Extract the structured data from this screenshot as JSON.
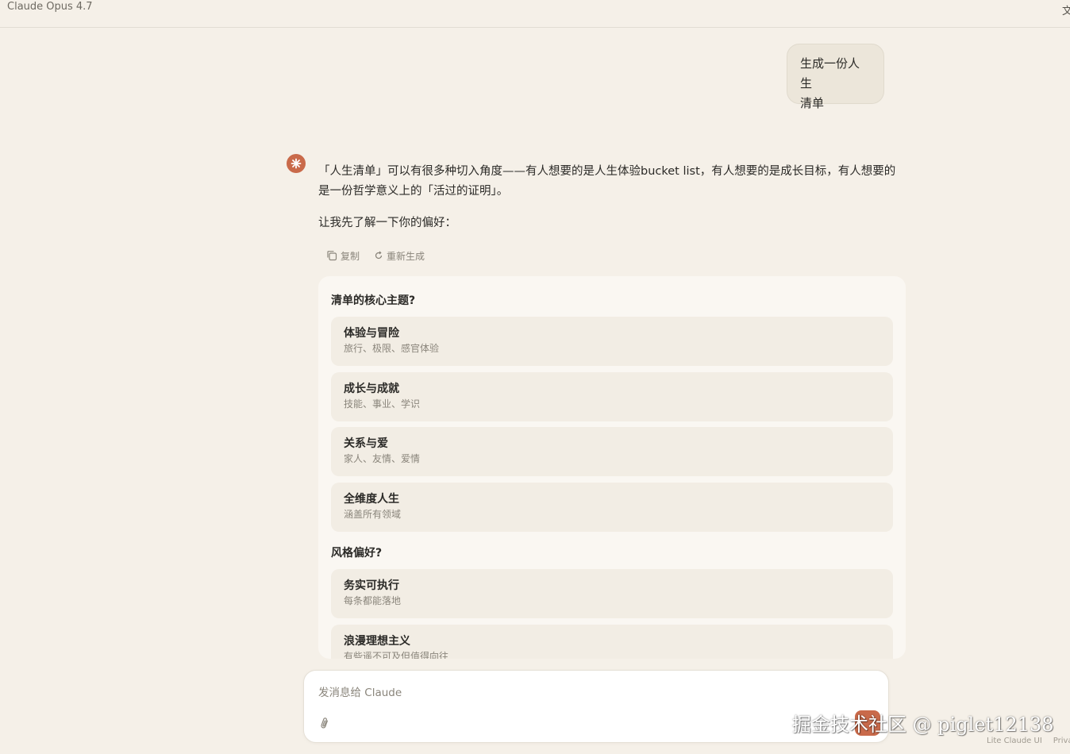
{
  "header": {
    "model_name": "Claude Opus 4.7",
    "translate_glyph": "文"
  },
  "user_message": {
    "line1": "生成一份人生",
    "line2": "清单"
  },
  "assistant": {
    "paragraph1": "「人生清单」可以有很多种切入角度——有人想要的是人生体验bucket list，有人想要的是成长目标，有人想要的是一份哲学意义上的「活过的证明」。",
    "paragraph2": "让我先了解一下你的偏好：",
    "copy_label": "复制",
    "regenerate_label": "重新生成"
  },
  "questions": [
    {
      "title": "清单的核心主题?",
      "options": [
        {
          "title": "体验与冒险",
          "subtitle": "旅行、极限、感官体验"
        },
        {
          "title": "成长与成就",
          "subtitle": "技能、事业、学识"
        },
        {
          "title": "关系与爱",
          "subtitle": "家人、友情、爱情"
        },
        {
          "title": "全维度人生",
          "subtitle": "涵盖所有领域"
        }
      ]
    },
    {
      "title": "风格偏好?",
      "options": [
        {
          "title": "务实可执行",
          "subtitle": "每条都能落地"
        },
        {
          "title": "浪漫理想主义",
          "subtitle": "有些遥不可及但值得向往"
        }
      ]
    }
  ],
  "composer": {
    "placeholder": "发消息给 Claude"
  },
  "watermark": "掘金技术社区 @ piglet12138",
  "footer": {
    "link1": "Lite Claude UI",
    "link2": "Priva"
  },
  "colors": {
    "background": "#f5f0e8",
    "accent": "#c96a4a",
    "card": "#faf7f2",
    "option": "#f2ede4"
  }
}
